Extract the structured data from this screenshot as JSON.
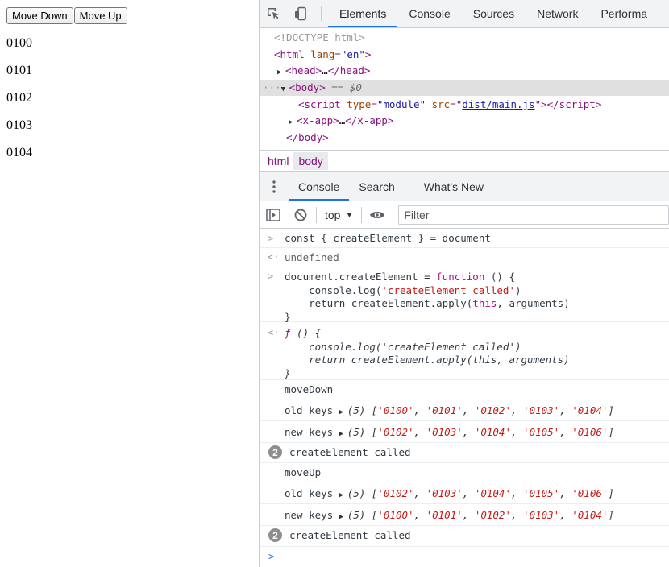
{
  "page": {
    "buttons": {
      "move_down": "Move Down",
      "move_up": "Move Up"
    },
    "items": [
      "0100",
      "0101",
      "0102",
      "0103",
      "0104"
    ]
  },
  "devtools": {
    "tabs": [
      "Elements",
      "Console",
      "Sources",
      "Network",
      "Performa"
    ],
    "active_tab": "Elements",
    "dom": {
      "doctype": "<!DOCTYPE html>",
      "html_tag": "html",
      "html_attr": "lang",
      "html_attr_val": "\"en\"",
      "head": "head",
      "body": "body",
      "body_marker": "== $0",
      "script_tag": "script",
      "script_type_attr": "type",
      "script_type_val": "\"module\"",
      "script_src_attr": "src",
      "script_src_val": "dist/main.js",
      "xapp": "x-app",
      "ellipsis": "…"
    },
    "breadcrumbs": [
      "html",
      "body"
    ],
    "drawer_tabs": [
      "Console",
      "Search",
      "What's New"
    ],
    "console_toolbar": {
      "context": "top",
      "filter_placeholder": "Filter"
    },
    "console": {
      "l1": "const { createElement } = document",
      "l2": "undefined",
      "l3a": "document.createElement = ",
      "l3kw": "function",
      "l3b": " () {",
      "l3c": "    console.log(",
      "l3str": "'createElement called'",
      "l3d": ")",
      "l3e": "    return createElement.apply(",
      "l3this": "this",
      "l3f": ", arguments)",
      "l3g": "}",
      "l4a": "ƒ",
      "l4b": " () {",
      "l4c": "    console.log('createElement called')",
      "l4d": "    return createElement.apply(this, arguments)",
      "l4e": "}",
      "move_down": "moveDown",
      "move_up": "moveUp",
      "old_keys": "old keys",
      "new_keys": "new keys",
      "arr_len": "(5)",
      "arr_a": [
        "'0100'",
        "'0101'",
        "'0102'",
        "'0103'",
        "'0104'"
      ],
      "arr_b": [
        "'0102'",
        "'0103'",
        "'0104'",
        "'0105'",
        "'0106'"
      ],
      "repeat_count": "2",
      "created_msg": "createElement called"
    }
  }
}
